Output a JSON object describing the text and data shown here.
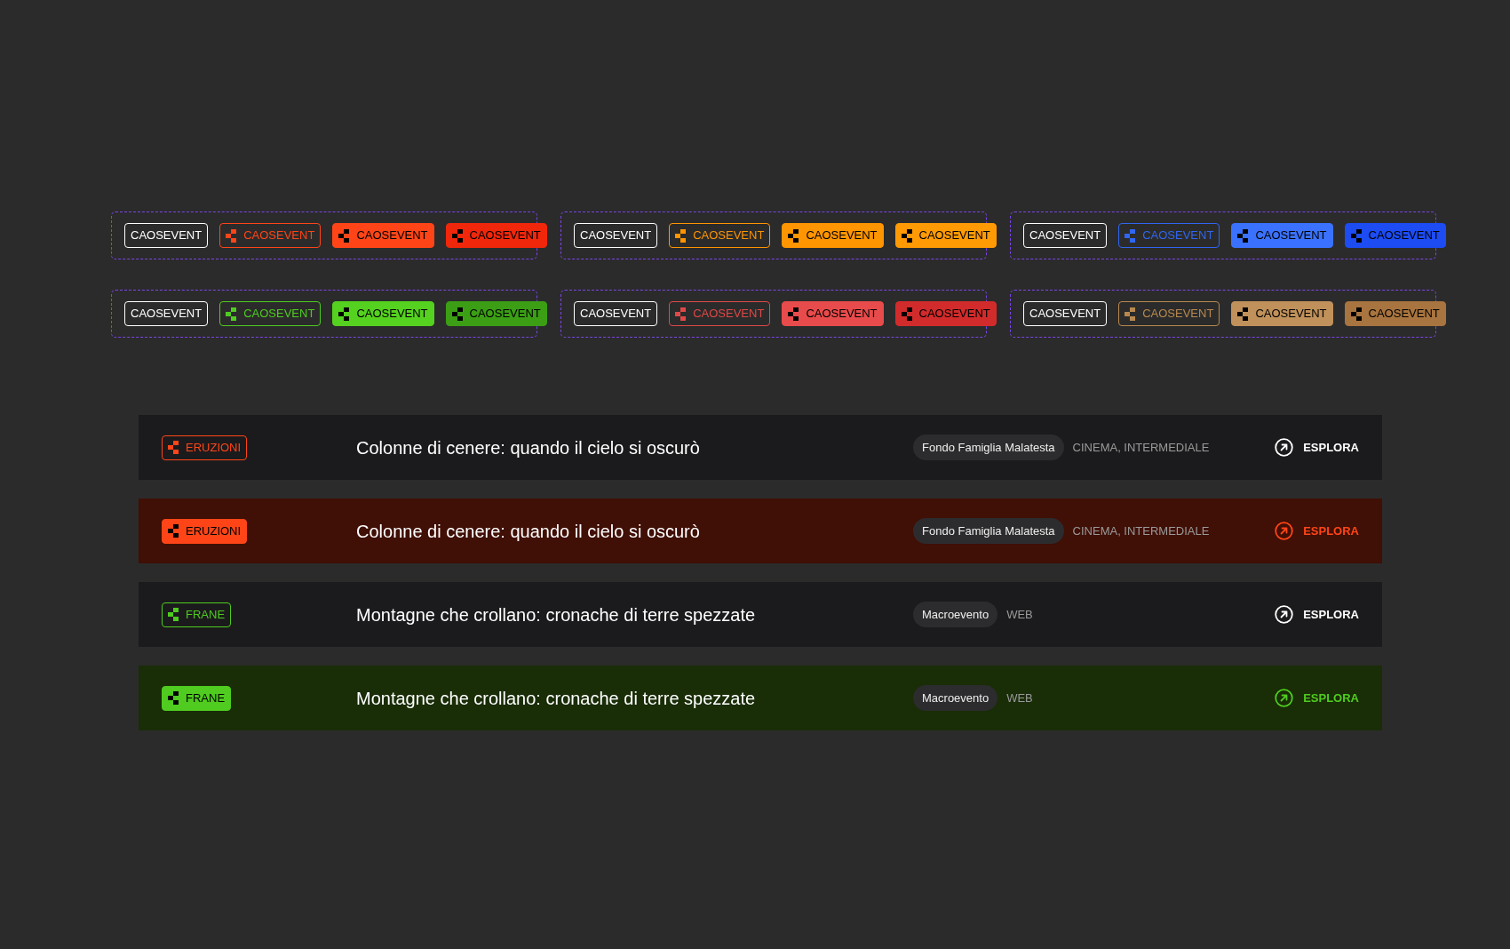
{
  "badge_groups": [
    {
      "badges": [
        {
          "label": "CAOSEVENT",
          "kind": "plain",
          "color": "#ffffff"
        },
        {
          "label": "CAOSEVENT",
          "kind": "outline",
          "color": "#ff4517"
        },
        {
          "label": "CAOSEVENT",
          "kind": "solid",
          "color": "#ff4517"
        },
        {
          "label": "CAOSEVENT",
          "kind": "solid",
          "color": "#f0270b"
        }
      ]
    },
    {
      "badges": [
        {
          "label": "CAOSEVENT",
          "kind": "plain",
          "color": "#ffffff"
        },
        {
          "label": "CAOSEVENT",
          "kind": "outline",
          "color": "#ff9500"
        },
        {
          "label": "CAOSEVENT",
          "kind": "solid",
          "color": "#ff9500"
        },
        {
          "label": "CAOSEVENT",
          "kind": "solid",
          "color": "#ff9a05"
        }
      ]
    },
    {
      "badges": [
        {
          "label": "CAOSEVENT",
          "kind": "plain",
          "color": "#ffffff"
        },
        {
          "label": "CAOSEVENT",
          "kind": "outline",
          "color": "#3066f0"
        },
        {
          "label": "CAOSEVENT",
          "kind": "solid",
          "color": "#3a72ff"
        },
        {
          "label": "CAOSEVENT",
          "kind": "solid",
          "color": "#1c4cf2"
        }
      ]
    },
    {
      "badges": [
        {
          "label": "CAOSEVENT",
          "kind": "plain",
          "color": "#ffffff"
        },
        {
          "label": "CAOSEVENT",
          "kind": "outline",
          "color": "#4fcc1f"
        },
        {
          "label": "CAOSEVENT",
          "kind": "solid",
          "color": "#55d11f"
        },
        {
          "label": "CAOSEVENT",
          "kind": "solid",
          "color": "#3b9e15"
        }
      ]
    },
    {
      "badges": [
        {
          "label": "CAOSEVENT",
          "kind": "plain",
          "color": "#ffffff"
        },
        {
          "label": "CAOSEVENT",
          "kind": "outline",
          "color": "#e04848"
        },
        {
          "label": "CAOSEVENT",
          "kind": "solid",
          "color": "#e84b4b"
        },
        {
          "label": "CAOSEVENT",
          "kind": "solid",
          "color": "#d22b2b"
        }
      ]
    },
    {
      "badges": [
        {
          "label": "CAOSEVENT",
          "kind": "plain",
          "color": "#ffffff"
        },
        {
          "label": "CAOSEVENT",
          "kind": "outline",
          "color": "#b8894f"
        },
        {
          "label": "CAOSEVENT",
          "kind": "solid",
          "color": "#c0915a"
        },
        {
          "label": "CAOSEVENT",
          "kind": "solid",
          "color": "#a8743f"
        }
      ]
    }
  ],
  "events": [
    {
      "tag": {
        "label": "ERUZIONI",
        "kind": "outline",
        "color": "#ff4517"
      },
      "highlighted": false,
      "title": "Colonne di cenere: quando il cielo si oscurò",
      "source": "Fondo Famiglia Malatesta",
      "categories": "CINEMA, INTERMEDIALE",
      "link": "ESPLORA"
    },
    {
      "tag": {
        "label": "ERUZIONI",
        "kind": "solid",
        "color": "#ff4517"
      },
      "highlighted": true,
      "title": "Colonne di cenere: quando il cielo si oscurò",
      "source": "Fondo Famiglia Malatesta",
      "categories": "CINEMA, INTERMEDIALE",
      "link": "ESPLORA"
    },
    {
      "tag": {
        "label": "FRANE",
        "kind": "outline",
        "color": "#4fcc1f"
      },
      "highlighted": false,
      "title": "Montagne che crollano: cronache di terre spezzate",
      "source": "Macroevento",
      "categories": "WEB",
      "link": "ESPLORA"
    },
    {
      "tag": {
        "label": "FRANE",
        "kind": "solid",
        "color": "#4fcc1f"
      },
      "highlighted": true,
      "title": "Montagne che crollano: cronache di terre spezzate",
      "source": "Macroevento",
      "categories": "WEB",
      "link": "ESPLORA"
    }
  ]
}
